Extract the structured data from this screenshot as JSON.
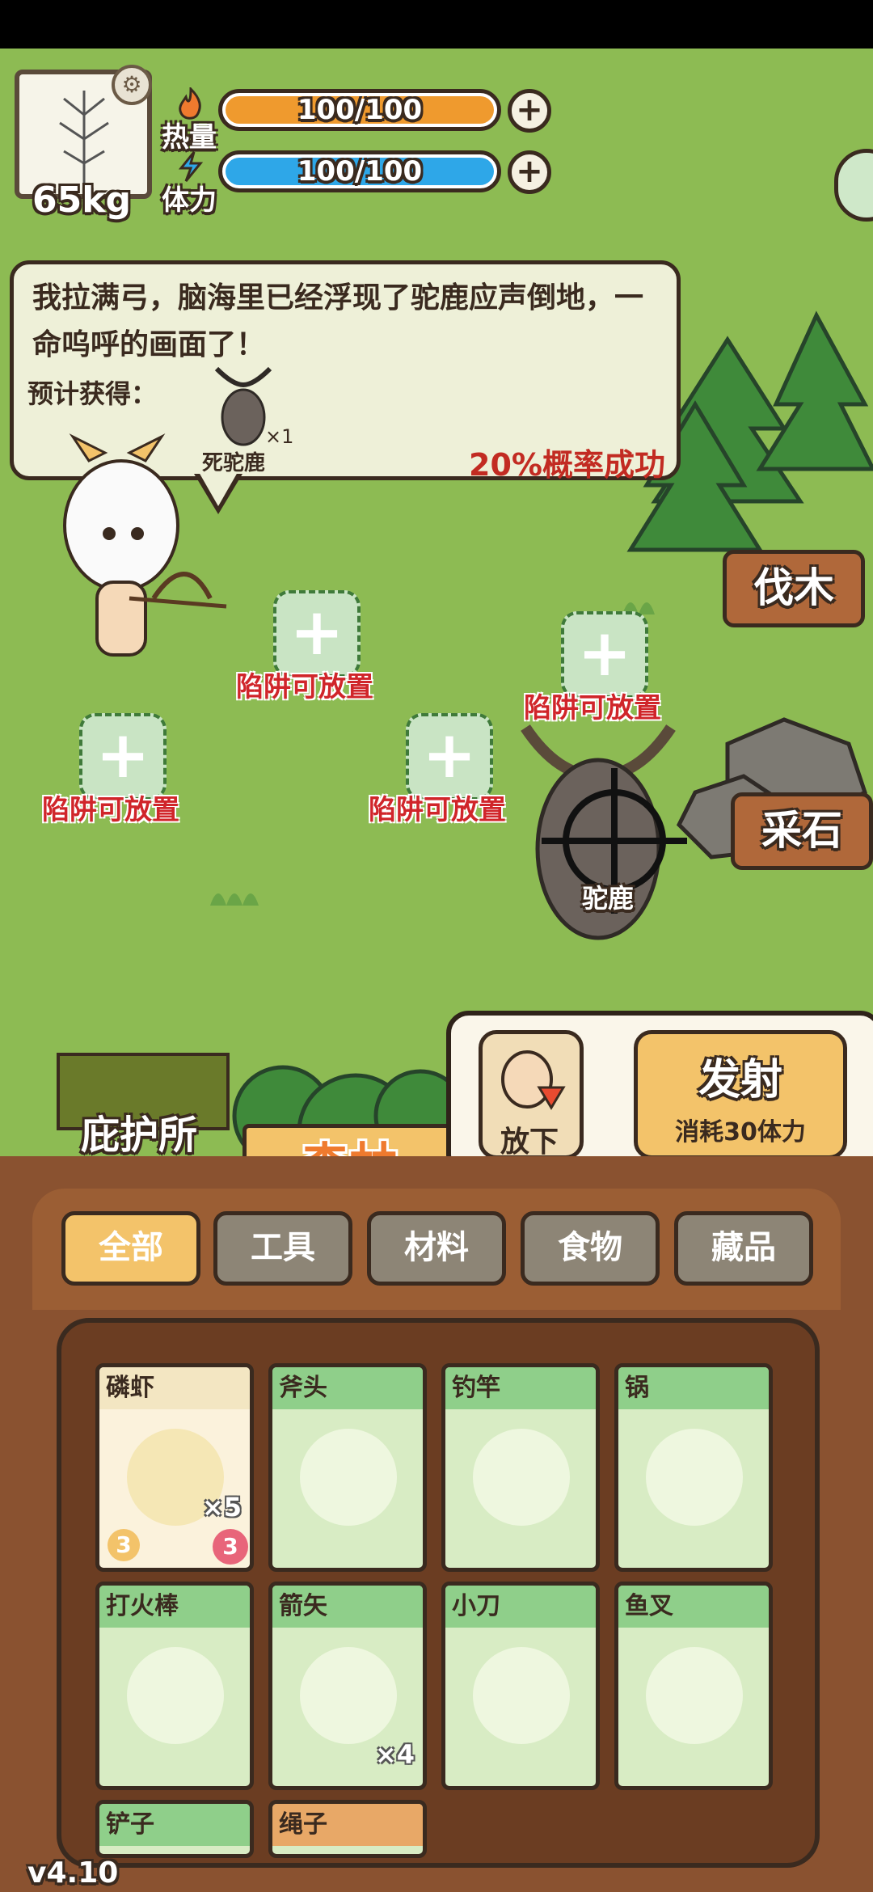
{
  "player": {
    "weight": "65kg"
  },
  "stats": {
    "heat": {
      "label": "热量",
      "value": "100/100",
      "fraction": 1.0,
      "color": "#ef9a2e"
    },
    "stamina": {
      "label": "体力",
      "value": "100/100",
      "fraction": 1.0,
      "color": "#2ea7e8"
    }
  },
  "dialog": {
    "text": "我拉满弓，脑海里已经浮现了驼鹿应声倒地，一命呜呼的画面了！",
    "expect_label": "预计获得：",
    "loot_name": "死驼鹿",
    "loot_count": "×1",
    "chance": "20%概率成功"
  },
  "traps": [
    {
      "label": "陷阱可放置"
    },
    {
      "label": "陷阱可放置"
    },
    {
      "label": "陷阱可放置"
    },
    {
      "label": "陷阱可放置"
    }
  ],
  "target": {
    "name": "驼鹿"
  },
  "signs": {
    "wood": "伐木",
    "stone": "采石"
  },
  "location": {
    "shelter": "庇护所",
    "current": "森林"
  },
  "actions": {
    "drop": "放下",
    "fire": "发射",
    "fire_cost": "消耗30体力"
  },
  "tabs": [
    {
      "label": "全部",
      "active": true
    },
    {
      "label": "工具",
      "active": false
    },
    {
      "label": "材料",
      "active": false
    },
    {
      "label": "食物",
      "active": false
    },
    {
      "label": "藏品",
      "active": false
    }
  ],
  "inventory": [
    {
      "name": "磷虾",
      "qty": "×5",
      "badge_left": "3",
      "badge_right": "3",
      "icon": "shrimp-icon"
    },
    {
      "name": "斧头",
      "qty": "",
      "icon": "axe-icon"
    },
    {
      "name": "钓竿",
      "qty": "",
      "icon": "fishing-rod-icon"
    },
    {
      "name": "锅",
      "qty": "",
      "icon": "pot-icon"
    },
    {
      "name": "打火棒",
      "qty": "",
      "icon": "fire-stick-icon"
    },
    {
      "name": "箭矢",
      "qty": "×4",
      "icon": "arrow-icon"
    },
    {
      "name": "小刀",
      "qty": "",
      "icon": "knife-icon"
    },
    {
      "name": "鱼叉",
      "qty": "",
      "icon": "fish-spear-icon"
    },
    {
      "name": "铲子",
      "qty": "",
      "icon": "shovel-icon"
    },
    {
      "name": "绳子",
      "qty": "",
      "icon": "rope-icon"
    }
  ],
  "version": "v4.10"
}
